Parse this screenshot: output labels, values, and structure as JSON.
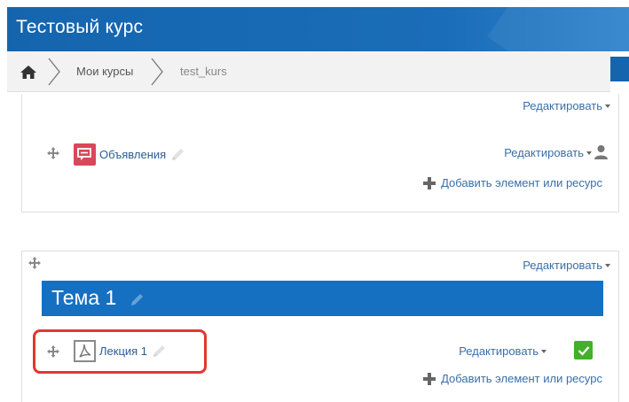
{
  "header": {
    "course_title": "Тестовый курс"
  },
  "breadcrumb": {
    "home_icon": "home-icon",
    "items": [
      "Мои курсы",
      "test_kurs"
    ]
  },
  "section0": {
    "edit_label": "Редактировать",
    "activity": {
      "icon": "forum-icon",
      "name": "Объявления",
      "edit_label": "Редактировать"
    },
    "add_label": "Добавить элемент или ресурс"
  },
  "section1": {
    "edit_label": "Редактировать",
    "topic_title": "Тема 1",
    "activity": {
      "icon": "pdf-resource-icon",
      "name": "Лекция 1",
      "edit_label": "Редактировать"
    },
    "add_label": "Добавить элемент или ресурс"
  },
  "colors": {
    "header_blue": "#1565ae",
    "topic_blue": "#1570c2",
    "forum_red": "#d9485a",
    "highlight_red": "#e0382f",
    "check_green": "#43b02a"
  }
}
